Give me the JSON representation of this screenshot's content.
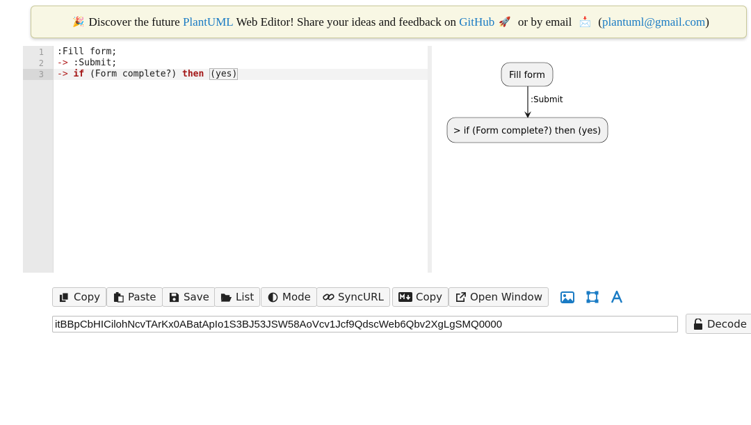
{
  "banner": {
    "emoji_party": "🎉",
    "text1": "Discover the future ",
    "link_plantuml": "PlantUML",
    "text2": " Web Editor! Share your ideas and feedback on ",
    "link_github": "GitHub",
    "emoji_rocket": "🚀",
    "text3": " or by email ",
    "emoji_inbox": "📩",
    "paren_open": " (",
    "link_email": "plantuml@gmail.com",
    "paren_close": ")"
  },
  "editor": {
    "line_numbers": [
      "1",
      "2",
      "3"
    ],
    "lines": [
      {
        "plain": ":Fill form;"
      },
      {
        "arrow": "->",
        "rest": " :Submit;"
      },
      {
        "arrow": "->",
        "kw_if": "if",
        "cond": " (Form complete?) ",
        "kw_then": "then",
        "space": " ",
        "yes": "(yes)"
      }
    ]
  },
  "diagram": {
    "node_start": "Fill form",
    "edge_label": ":Submit",
    "node_end": "> if (Form complete?) then (yes)"
  },
  "toolbar": {
    "copy": "Copy",
    "paste": "Paste",
    "save": "Save",
    "list": "List",
    "mode": "Mode",
    "syncurl": "SyncURL",
    "md_copy": "Copy",
    "open_window": "Open Window",
    "icons": [
      "image-icon",
      "vector-icon",
      "ascii-icon"
    ],
    "accent_color": "#1a7bc4"
  },
  "encoded": {
    "value": "itBBpCbHICilohNcvTArKx0ABatApIo1S3BJ53JSW58AoVcv1Jcf9QdscWeb6Qbv2XgLgSMQ0000",
    "decode_label": "Decode"
  }
}
